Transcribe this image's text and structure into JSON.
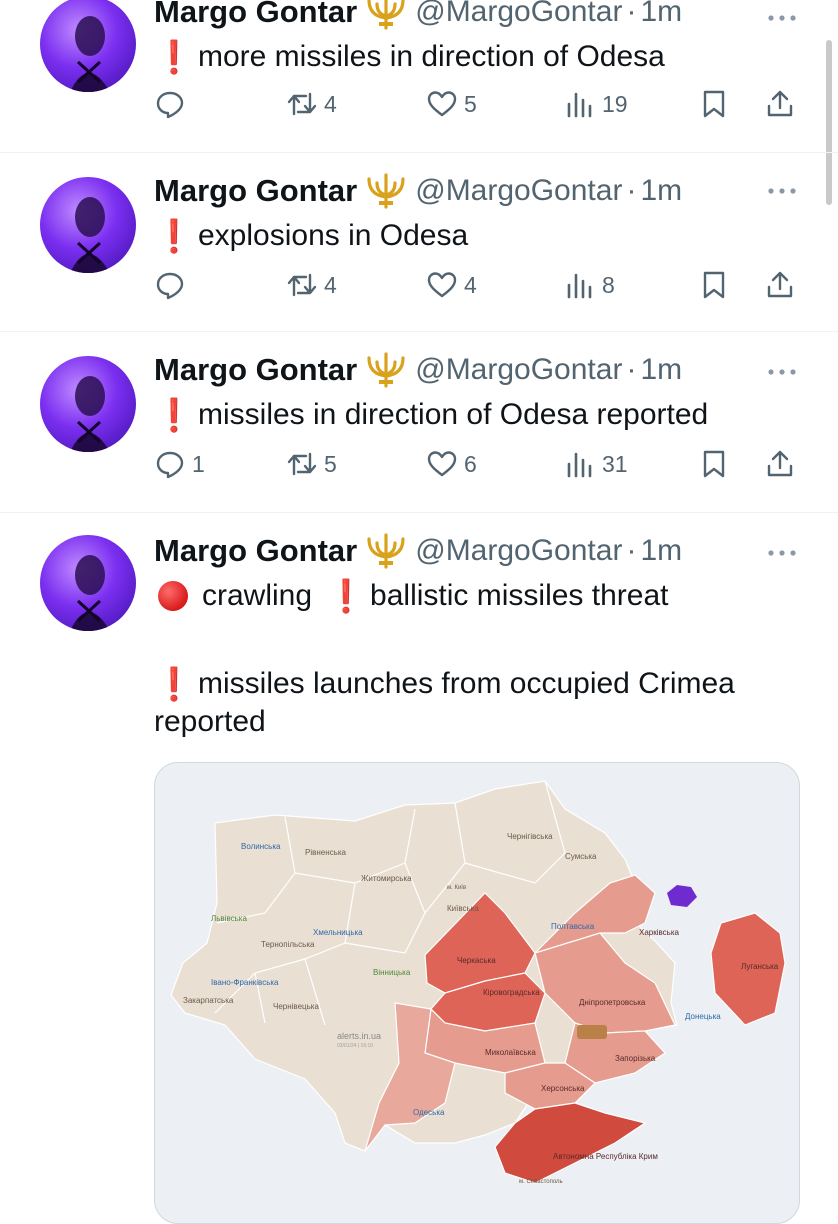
{
  "tweets": [
    {
      "name": "Margo Gontar",
      "handle": "@MargoGontar",
      "time": "1m",
      "lines": [
        "more missiles in direction of Odesa"
      ],
      "stats": {
        "replies": "",
        "retweets": "4",
        "likes": "5",
        "views": "19"
      }
    },
    {
      "name": "Margo Gontar",
      "handle": "@MargoGontar",
      "time": "1m",
      "lines": [
        "explosions in Odesa"
      ],
      "stats": {
        "replies": "",
        "retweets": "4",
        "likes": "4",
        "views": "8"
      }
    },
    {
      "name": "Margo Gontar",
      "handle": "@MargoGontar",
      "time": "1m",
      "lines": [
        "missiles in direction of Odesa reported"
      ],
      "stats": {
        "replies": "1",
        "retweets": "5",
        "likes": "6",
        "views": "31"
      }
    },
    {
      "name": "Margo Gontar",
      "handle": "@MargoGontar",
      "time": "1m",
      "line1_a": "crawling",
      "line1_b": "ballistic missiles threat",
      "line2": "missiles launches from occupied Crimea",
      "line3": "reported"
    }
  ],
  "separator": "·",
  "map": {
    "watermark": "alerts.in.ua",
    "watermark_sub": "03/01/24 | 16:10",
    "regions": {
      "volyn": "Волинська",
      "rivne": "Рівненська",
      "zhytomyr": "Житомирська",
      "chernihiv": "Чернігівська",
      "sumy": "Сумська",
      "kyiv_city": "м. Київ",
      "kyiv": "Київська",
      "lviv": "Львівська",
      "ternopil": "Тернопільська",
      "khmelnytskyi": "Хмельницька",
      "poltava": "Полтавська",
      "kharkiv": "Харківська",
      "cherkasy": "Черкаська",
      "luhansk": "Луганська",
      "vinnytsia": "Вінницька",
      "ivano_frankivsk": "Івано-Франківська",
      "zakarpattia": "Закарпатська",
      "chernivtsi": "Чернівецька",
      "kirovohrad": "Кіровоградська",
      "dnipro": "Дніпропетровська",
      "donetsk": "Донецька",
      "mykolaiv": "Миколаївська",
      "zaporizhzhia": "Запорізька",
      "kherson": "Херсонська",
      "odesa": "Одеська",
      "crimea": "Автономна Республіка Крим",
      "sevastopol": "м. Севастополь"
    },
    "colors": {
      "calm": "#eadfd3",
      "alert_light": "#e59c8f",
      "alert": "#dd6456",
      "alert_dark": "#d04a3e"
    }
  }
}
